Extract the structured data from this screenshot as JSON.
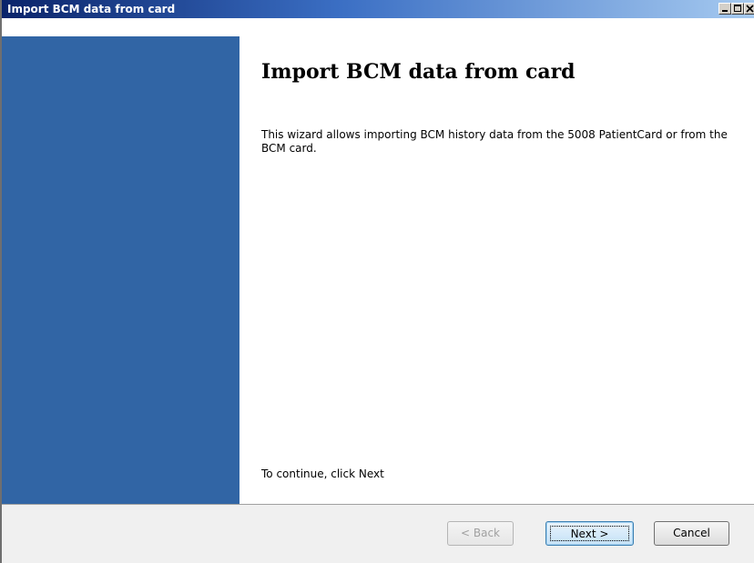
{
  "window": {
    "title": "Import BCM data from card",
    "controls": {
      "minimize_icon": "minimize-icon",
      "maximize_icon": "maximize-icon",
      "close_icon": "close-icon"
    }
  },
  "wizard": {
    "heading": "Import BCM data from card",
    "description": "This wizard allows importing BCM history data from the 5008 PatientCard or from the BCM card.",
    "continue_hint": "To continue, click Next",
    "sidebar_color": "#3165a5"
  },
  "buttons": {
    "back_label": "< Back",
    "next_label": "Next >",
    "cancel_label": "Cancel",
    "back_enabled": false
  }
}
